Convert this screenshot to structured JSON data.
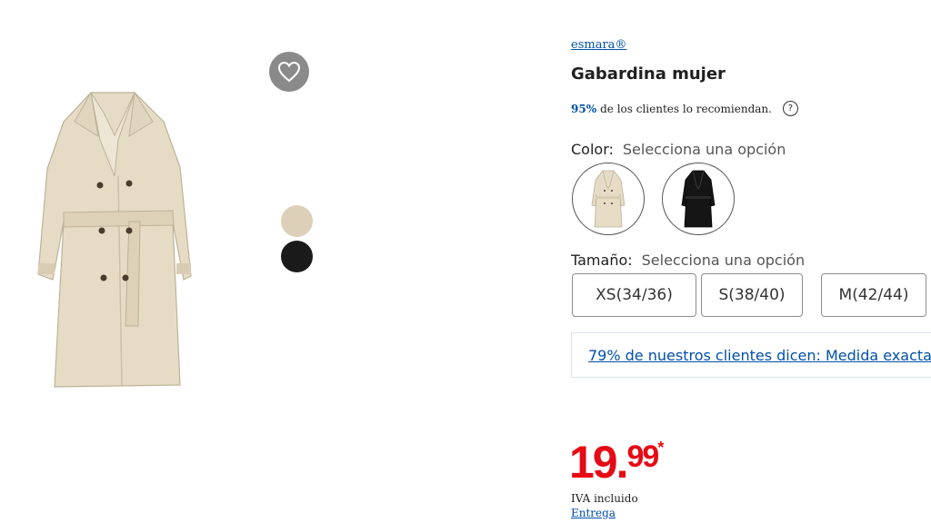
{
  "product": {
    "brand": "esmara®",
    "title": "Gabardina mujer",
    "recommend_pct": "95%",
    "recommend_text": "de los clientes lo recomiendan.",
    "help_icon": "?"
  },
  "gallery": {
    "favorite_icon": "heart-outline-icon",
    "thumbnails": [
      {
        "color": "#ddd0b8",
        "name": "beige"
      },
      {
        "color": "#1a1a1a",
        "name": "black"
      }
    ]
  },
  "color": {
    "label": "Color:",
    "value": "Selecciona una opción"
  },
  "size": {
    "label": "Tamaño:",
    "value": "Selecciona una opción",
    "options": [
      "XS(34/36)",
      "S(38/40)",
      "M(42/44)"
    ]
  },
  "fit": {
    "text": "79% de nuestros clientes dicen: Medida exacta"
  },
  "price": {
    "integer": "19.",
    "decimal": "99",
    "asterisk": "*",
    "vat": "IVA incluido",
    "delivery": "Entrega",
    "color": "#e60a14"
  },
  "colors": {
    "accent_link": "#0050aa",
    "beige_coat": "#e6dcc6",
    "black_coat": "#151515"
  }
}
